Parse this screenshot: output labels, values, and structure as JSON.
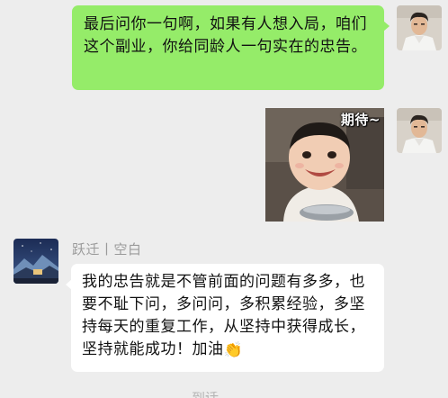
{
  "messages": {
    "outgoing_text": "最后问你一句啊，如果有人想入局，咱们这个副业，你给同龄人一句实在的忠告。",
    "sticker": {
      "caption": "期待~",
      "icon": "happy-toddler-sticker"
    },
    "incoming": {
      "sender_name": "跃迁丨空白",
      "text": "我的忠告就是不管前面的问题有多多，也要不耻下问，多问问，多积累经验，多坚持每天的重复工作，从坚持中获得成长，坚持就能成功！加油",
      "emoji": "👏"
    },
    "partial_bottom_text": "到话"
  },
  "colors": {
    "background": "#ededed",
    "outgoing_bubble": "#95ec69",
    "incoming_bubble": "#ffffff",
    "sender_name": "#9a9a9a"
  },
  "icons": {
    "self_avatar": "man-portrait-avatar",
    "other_avatar": "night-landscape-avatar"
  }
}
